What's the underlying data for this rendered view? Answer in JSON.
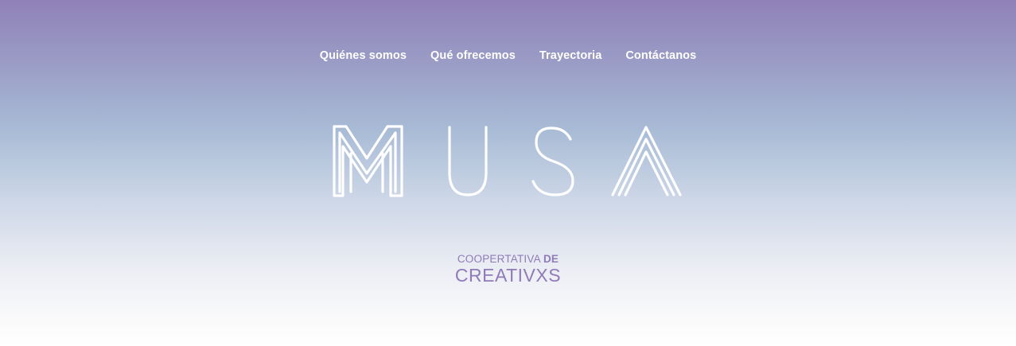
{
  "nav": {
    "items": [
      {
        "label": "Quiénes somos"
      },
      {
        "label": "Qué ofrecemos"
      },
      {
        "label": "Trayectoria"
      },
      {
        "label": "Contáctanos"
      }
    ]
  },
  "logo": {
    "text": "MUSA"
  },
  "tagline": {
    "line1_prefix": "COOPERTATIVA",
    "line1_bold": "DE",
    "line2": "CREATIVXS"
  },
  "colors": {
    "gradient_top": "#9081b7",
    "gradient_bottom": "#ffffff",
    "accent": "#8f7bb8",
    "nav_text": "#ffffff"
  }
}
